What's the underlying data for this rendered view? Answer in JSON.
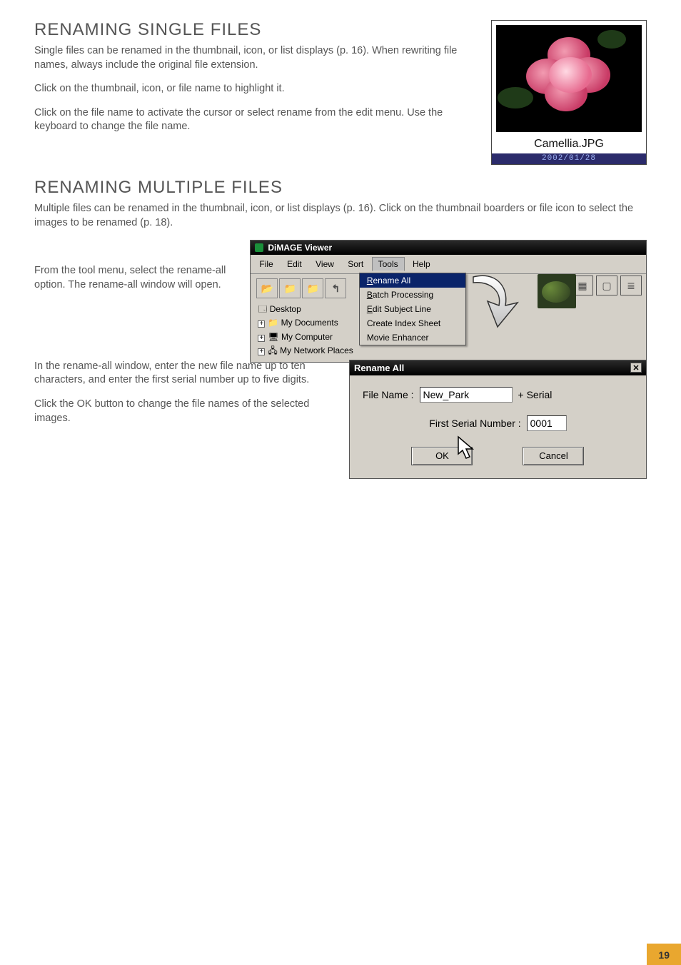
{
  "section1": {
    "title": "RENAMING SINGLE FILES",
    "p1": "Single files can be renamed in the thumbnail, icon, or list displays (p. 16). When rewriting file names, always include the original file extension.",
    "p2": "Click on the thumbnail, icon, or file name to highlight it.",
    "p3": "Click on the file name to activate the cursor or select rename from the edit menu. Use the keyboard to change the file name."
  },
  "thumbnail": {
    "caption": "Camellia.JPG",
    "date": "2002/01/28"
  },
  "section2": {
    "title": "RENAMING MULTIPLE FILES",
    "p1": "Multiple files can be renamed in the thumbnail, icon, or list displays (p. 16). Click on the thumbnail boarders or file icon to select the images to be renamed (p. 18).",
    "instr1": "From the tool menu, select the rename-all option. The rename-all window will open.",
    "instr2": "In the rename-all window, enter the new file name up to ten characters, and enter the first serial number up to five digits.",
    "instr3": "Click the OK button to change the file names of the selected images."
  },
  "dimage": {
    "title": "DiMAGE Viewer",
    "menubar": [
      "File",
      "Edit",
      "View",
      "Sort",
      "Tools",
      "Help"
    ],
    "tree": {
      "desktop": "Desktop",
      "mydocs": "My Documents",
      "mycomp": "My Computer",
      "mynet": "My Network Places"
    },
    "tools_menu": {
      "rename_all": "Rename All",
      "batch": "Batch Processing",
      "subject": "Edit Subject Line",
      "index": "Create Index Sheet",
      "movie": "Movie Enhancer"
    }
  },
  "rename_dialog": {
    "title": "Rename All",
    "file_name_label": "File Name :",
    "file_name_value": "New_Park",
    "serial_suffix": "+ Serial",
    "serial_label": "First Serial Number :",
    "serial_value": "0001",
    "ok": "OK",
    "cancel": "Cancel"
  },
  "page_number": "19"
}
